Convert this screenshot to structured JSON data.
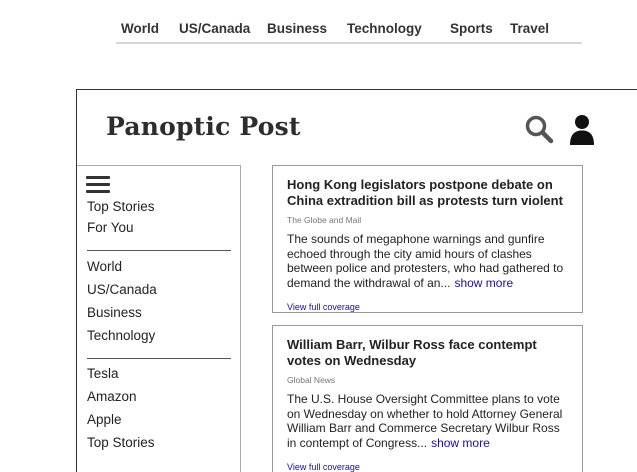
{
  "topnav": {
    "items": [
      "World",
      "US/Canada",
      "Business",
      "Technology",
      "Sports",
      "Travel"
    ]
  },
  "brand": {
    "name": "Panoptic Post"
  },
  "header_icons": {
    "search": "search-icon",
    "account": "user-icon"
  },
  "sidebar": {
    "menu_icon": "hamburger-menu-icon",
    "group1": [
      "Top Stories",
      "For You"
    ],
    "group2": [
      "World",
      "US/Canada",
      "Business",
      "Technology"
    ],
    "group3": [
      "Tesla",
      "Amazon",
      "Apple",
      "Top Stories"
    ]
  },
  "articles": [
    {
      "title": "Hong Kong legislators postpone debate on China extradition bill as protests turn violent",
      "source": "The Globe and Mail",
      "snippet": "The sounds of megaphone warnings and gunfire echoed through the city amid hours of clashes between police and protesters, who had gathered to demand the withdrawal of an...",
      "show_more": "show more",
      "coverage": "View full coverage"
    },
    {
      "title": "William Barr, Wilbur Ross face contempt votes on Wednesday",
      "source": "Global News",
      "snippet": "The U.S. House Oversight Committee plans to vote on Wednesday on whether to hold Attorney General William Barr and Commerce Secretary Wilbur Ross in contempt of Congress...",
      "show_more": "show more",
      "coverage": "View full coverage"
    }
  ],
  "colors": {
    "link": "#1a0dab",
    "text": "#222222",
    "border": "#999999"
  }
}
